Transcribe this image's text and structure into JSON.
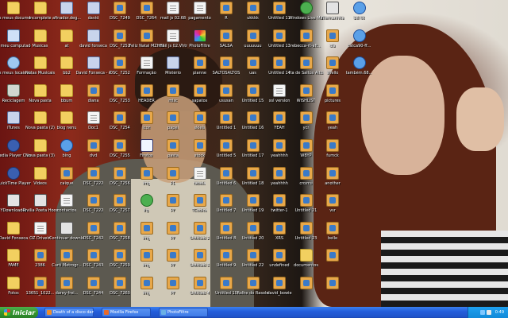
{
  "desktop": {
    "icons": [
      {
        "label": "Os meus documentos",
        "glyph": "folder",
        "icon": "my-documents-icon"
      },
      {
        "label": "O meu computador",
        "glyph": "pc",
        "icon": "my-computer-icon"
      },
      {
        "label": "Os meus locais na rede",
        "glyph": "net",
        "icon": "network-places-icon"
      },
      {
        "label": "Reciclagem",
        "glyph": "trash",
        "icon": "recycle-bin-icon"
      },
      {
        "label": "iTunes",
        "glyph": "music",
        "icon": "itunes-icon"
      },
      {
        "label": "Media Player Classic",
        "glyph": "media",
        "icon": "media-player-icon"
      },
      {
        "label": "QuickTime Player",
        "glyph": "media",
        "icon": "quicktime-icon"
      },
      {
        "label": "YDownloader",
        "glyph": "prog",
        "icon": "program-icon"
      },
      {
        "label": "David Fonseca",
        "glyph": "folder",
        "icon": "folder-icon"
      },
      {
        "label": "FAME",
        "glyph": "folder",
        "icon": "folder-icon"
      },
      {
        "label": "Fotos",
        "glyph": "folder",
        "icon": "folder-icon"
      },
      {
        "label": "Incomplete",
        "glyph": "folder",
        "icon": "folder-icon"
      },
      {
        "label": "Musicas",
        "glyph": "folder",
        "icon": "folder-icon"
      },
      {
        "label": "Notas Musicais",
        "glyph": "folder",
        "icon": "folder-icon"
      },
      {
        "label": "Nova pasta",
        "glyph": "folder",
        "icon": "folder-icon"
      },
      {
        "label": "Nova pasta (2)",
        "glyph": "folder",
        "icon": "folder-icon"
      },
      {
        "label": "Nova pasta (3)",
        "glyph": "folder",
        "icon": "folder-icon"
      },
      {
        "label": "Videos",
        "glyph": "folder",
        "icon": "folder-icon"
      },
      {
        "label": "Rivilia Poeta Hoodline",
        "glyph": "prog",
        "icon": "program-icon"
      },
      {
        "label": "OZ Drivein",
        "glyph": "doc",
        "icon": "document-icon"
      },
      {
        "label": "2386",
        "glyph": "img",
        "icon": "image-icon"
      },
      {
        "label": "13651_1022...",
        "glyph": "img",
        "icon": "image-icon"
      },
      {
        "label": "afinador.deg...",
        "glyph": "music",
        "icon": "audio-file-icon"
      },
      {
        "label": "at",
        "glyph": "folder",
        "icon": "folder-icon"
      },
      {
        "label": "bb2",
        "glyph": "folder",
        "icon": "folder-icon"
      },
      {
        "label": "bbum",
        "glyph": "folder",
        "icon": "folder-icon"
      },
      {
        "label": "blog nenu",
        "glyph": "folder",
        "icon": "folder-icon"
      },
      {
        "label": "bing",
        "glyph": "ie",
        "icon": "browser-icon"
      },
      {
        "label": "caique",
        "glyph": "img",
        "icon": "image-icon"
      },
      {
        "label": "contactos",
        "glyph": "doc",
        "icon": "document-icon"
      },
      {
        "label": "Continuar download",
        "glyph": "prog",
        "icon": "program-icon"
      },
      {
        "label": "Curti Metrogr...",
        "glyph": "img",
        "icon": "image-icon"
      },
      {
        "label": "darey-frei...",
        "glyph": "img",
        "icon": "image-icon"
      },
      {
        "label": "david",
        "glyph": "music",
        "icon": "audio-file-icon"
      },
      {
        "label": "david fonseca",
        "glyph": "music",
        "icon": "audio-file-icon"
      },
      {
        "label": "David Fonseca - Angle Said...",
        "glyph": "music",
        "icon": "audio-file-icon"
      },
      {
        "label": "diana",
        "glyph": "img",
        "icon": "image-icon"
      },
      {
        "label": "Doc1",
        "glyph": "doc",
        "icon": "document-icon"
      },
      {
        "label": "dvd",
        "glyph": "img",
        "icon": "image-icon"
      },
      {
        "label": "DSC_7222",
        "glyph": "img",
        "icon": "image-icon"
      },
      {
        "label": "DSC_7222",
        "glyph": "img",
        "icon": "image-icon"
      },
      {
        "label": "DSC_7242",
        "glyph": "img",
        "icon": "image-icon"
      },
      {
        "label": "DSC_7243",
        "glyph": "img",
        "icon": "image-icon"
      },
      {
        "label": "DSC_7244",
        "glyph": "img",
        "icon": "image-icon"
      },
      {
        "label": "DSC_7249",
        "glyph": "img",
        "icon": "image-icon"
      },
      {
        "label": "DSC_7251",
        "glyph": "img",
        "icon": "image-icon"
      },
      {
        "label": "DSC_7252",
        "glyph": "img",
        "icon": "image-icon"
      },
      {
        "label": "DSC_7253",
        "glyph": "img",
        "icon": "image-icon"
      },
      {
        "label": "DSC_7254",
        "glyph": "img",
        "icon": "image-icon"
      },
      {
        "label": "DSC_7255",
        "glyph": "img",
        "icon": "image-icon"
      },
      {
        "label": "DSC_7256",
        "glyph": "img",
        "icon": "image-icon"
      },
      {
        "label": "DSC_7257",
        "glyph": "img",
        "icon": "image-icon"
      },
      {
        "label": "DSC_7258",
        "glyph": "img",
        "icon": "image-icon"
      },
      {
        "label": "DSC_7259",
        "glyph": "img",
        "icon": "image-icon"
      },
      {
        "label": "DSC_7260",
        "glyph": "img",
        "icon": "image-icon"
      },
      {
        "label": "DSC_7264",
        "glyph": "img",
        "icon": "image-icon"
      },
      {
        "label": "Feliz Natal MZHBR",
        "glyph": "img",
        "icon": "image-icon"
      },
      {
        "label": "Formação",
        "glyph": "doc",
        "icon": "document-icon"
      },
      {
        "label": "HEADER",
        "glyph": "img",
        "icon": "image-icon"
      },
      {
        "label": "icon",
        "glyph": "img",
        "icon": "image-icon"
      },
      {
        "label": "Firefox",
        "glyph": "web",
        "icon": "firefox-icon"
      },
      {
        "label": "img",
        "glyph": "img",
        "icon": "image-icon"
      },
      {
        "label": "ihp",
        "glyph": "msn",
        "icon": "program-icon"
      },
      {
        "label": "img",
        "glyph": "img",
        "icon": "image-icon"
      },
      {
        "label": "img",
        "glyph": "img",
        "icon": "image-icon"
      },
      {
        "label": "img",
        "glyph": "img",
        "icon": "image-icon"
      },
      {
        "label": "mail js 02.68",
        "glyph": "doc",
        "icon": "document-icon"
      },
      {
        "label": "mail js 02.Vhtr",
        "glyph": "doc",
        "icon": "document-icon"
      },
      {
        "label": "Mistério",
        "glyph": "music",
        "icon": "audio-file-icon"
      },
      {
        "label": "misc",
        "glyph": "img",
        "icon": "image-icon"
      },
      {
        "label": "papel",
        "glyph": "img",
        "icon": "image-icon"
      },
      {
        "label": "pasta",
        "glyph": "img",
        "icon": "image-icon"
      },
      {
        "label": "PD",
        "glyph": "img",
        "icon": "image-icon"
      },
      {
        "label": "PF",
        "glyph": "img",
        "icon": "image-icon"
      },
      {
        "label": "PF",
        "glyph": "img",
        "icon": "image-icon"
      },
      {
        "label": "PF",
        "glyph": "img",
        "icon": "image-icon"
      },
      {
        "label": "PF",
        "glyph": "img",
        "icon": "image-icon"
      },
      {
        "label": "pagamento",
        "glyph": "doc",
        "icon": "document-icon"
      },
      {
        "label": "PhotoFiltre",
        "glyph": "color",
        "icon": "photofiltre-icon"
      },
      {
        "label": "pianne",
        "glyph": "img",
        "icon": "image-icon"
      },
      {
        "label": "sapatos",
        "glyph": "img",
        "icon": "image-icon"
      },
      {
        "label": "skiels",
        "glyph": "img",
        "icon": "image-icon"
      },
      {
        "label": "stock",
        "glyph": "img",
        "icon": "image-icon"
      },
      {
        "label": "tabela",
        "glyph": "doc",
        "icon": "document-icon"
      },
      {
        "label": "TCodice",
        "glyph": "img",
        "icon": "image-icon"
      },
      {
        "label": "Untitled 2",
        "glyph": "img",
        "icon": "image-icon"
      },
      {
        "label": "Untitled 3",
        "glyph": "img",
        "icon": "image-icon"
      },
      {
        "label": "Untitled 4",
        "glyph": "img",
        "icon": "image-icon"
      },
      {
        "label": "R",
        "glyph": "img",
        "icon": "image-icon"
      },
      {
        "label": "SALSA",
        "glyph": "img",
        "icon": "image-icon"
      },
      {
        "label": "SALTOSALTOS",
        "glyph": "img",
        "icon": "image-icon"
      },
      {
        "label": "ususan",
        "glyph": "img",
        "icon": "image-icon"
      },
      {
        "label": "Untitled 1",
        "glyph": "img",
        "icon": "image-icon"
      },
      {
        "label": "Untitled 5",
        "glyph": "img",
        "icon": "image-icon"
      },
      {
        "label": "Untitled 6",
        "glyph": "img",
        "icon": "image-icon"
      },
      {
        "label": "Untitled 7",
        "glyph": "img",
        "icon": "image-icon"
      },
      {
        "label": "Untitled 8",
        "glyph": "img",
        "icon": "image-icon"
      },
      {
        "label": "Untitled 9",
        "glyph": "img",
        "icon": "image-icon"
      },
      {
        "label": "Untitled 10",
        "glyph": "img",
        "icon": "image-icon"
      },
      {
        "label": "ukkkk",
        "glyph": "img",
        "icon": "image-icon"
      },
      {
        "label": "uuuuuuu",
        "glyph": "img",
        "icon": "image-icon"
      },
      {
        "label": "uas",
        "glyph": "img",
        "icon": "image-icon"
      },
      {
        "label": "Untitled 15",
        "glyph": "img",
        "icon": "image-icon"
      },
      {
        "label": "Untitled 16",
        "glyph": "img",
        "icon": "image-icon"
      },
      {
        "label": "Untitled 17",
        "glyph": "img",
        "icon": "image-icon"
      },
      {
        "label": "Untitled 18",
        "glyph": "img",
        "icon": "image-icon"
      },
      {
        "label": "Untitled 19",
        "glyph": "img",
        "icon": "image-icon"
      },
      {
        "label": "Untitled 20",
        "glyph": "img",
        "icon": "image-icon"
      },
      {
        "label": "Untitled 22",
        "glyph": "img",
        "icon": "image-icon"
      },
      {
        "label": "Rolhe do Rasolo",
        "glyph": "img",
        "icon": "image-icon"
      },
      {
        "label": "Untitled 11",
        "glyph": "img",
        "icon": "image-icon"
      },
      {
        "label": "Untitled 13",
        "glyph": "img",
        "icon": "image-icon"
      },
      {
        "label": "Untitled 14",
        "glyph": "img",
        "icon": "image-icon"
      },
      {
        "label": "xsl version",
        "glyph": "doc",
        "icon": "document-icon"
      },
      {
        "label": "YEAH",
        "glyph": "img",
        "icon": "image-icon"
      },
      {
        "label": "yeahhhh",
        "glyph": "img",
        "icon": "image-icon"
      },
      {
        "label": "yeahhhh",
        "glyph": "img",
        "icon": "image-icon"
      },
      {
        "label": "twitter-1",
        "glyph": "img",
        "icon": "image-icon"
      },
      {
        "label": "XRS",
        "glyph": "img",
        "icon": "image-icon"
      },
      {
        "label": "undefined",
        "glyph": "img",
        "icon": "image-icon"
      },
      {
        "label": "david_bowie",
        "glyph": "img",
        "icon": "image-icon"
      },
      {
        "label": "Windows Live Messenger",
        "glyph": "msn",
        "icon": "messenger-icon"
      },
      {
        "label": "rebecca-rt-aft...",
        "glyph": "img",
        "icon": "image-icon"
      },
      {
        "label": "rta de Saltos Altos",
        "glyph": "img",
        "icon": "image-icon"
      },
      {
        "label": "WISHLIST",
        "glyph": "img",
        "icon": "image-icon"
      },
      {
        "label": "ycr",
        "glyph": "img",
        "icon": "image-icon"
      },
      {
        "label": "WBYP",
        "glyph": "img",
        "icon": "image-icon"
      },
      {
        "label": "crozcu",
        "glyph": "img",
        "icon": "image-icon"
      },
      {
        "label": "Untitled 21",
        "glyph": "img",
        "icon": "image-icon"
      },
      {
        "label": "Untitled 23",
        "glyph": "img",
        "icon": "image-icon"
      },
      {
        "label": "documentos",
        "glyph": "folder",
        "icon": "folder-icon"
      },
      {
        "label": "",
        "glyph": "img",
        "icon": "image-icon"
      },
      {
        "label": "Filemanhite",
        "glyph": "prog",
        "icon": "program-icon"
      },
      {
        "label": "ola",
        "glyph": "img",
        "icon": "image-icon"
      },
      {
        "label": "shello",
        "glyph": "img",
        "icon": "image-icon"
      },
      {
        "label": "pictures",
        "glyph": "img",
        "icon": "image-icon"
      },
      {
        "label": "yeah",
        "glyph": "img",
        "icon": "image-icon"
      },
      {
        "label": "fumck",
        "glyph": "img",
        "icon": "image-icon"
      },
      {
        "label": "another",
        "glyph": "img",
        "icon": "image-icon"
      },
      {
        "label": "vsr",
        "glyph": "img",
        "icon": "image-icon"
      },
      {
        "label": "belle",
        "glyph": "img",
        "icon": "image-icon"
      },
      {
        "label": "",
        "glyph": "img",
        "icon": "image-icon"
      },
      {
        "label": "",
        "glyph": "img",
        "icon": "image-icon"
      },
      {
        "label": "bill tit",
        "glyph": "ie",
        "icon": "browser-icon"
      },
      {
        "label": "catca90-ff...",
        "glyph": "ie",
        "icon": "browser-icon"
      },
      {
        "label": "também.68...",
        "glyph": "ie",
        "icon": "browser-icon"
      }
    ]
  },
  "taskbar": {
    "start_label": "Iniciar",
    "tasks": [
      {
        "label": "Death of a disco danc...",
        "color": "#f08c28"
      },
      {
        "label": "Mozilla Firefox",
        "color": "#e86a2a"
      },
      {
        "label": "PhotoFiltre",
        "color": "#6ab0e6"
      }
    ],
    "clock": "0:49"
  }
}
